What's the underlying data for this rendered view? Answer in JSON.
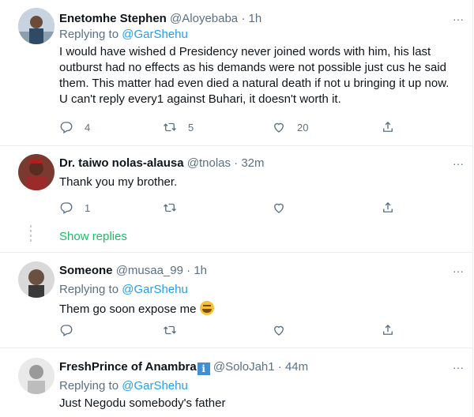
{
  "tweets": [
    {
      "name": "Enetomhe Stephen",
      "handle": "@Aloyebaba",
      "dot": "·",
      "time": "1h",
      "replying_label": "Replying to",
      "replying_to": "@GarShehu",
      "text": "I would have wished d Presidency never joined words with him, his last outburst had no effects as his demands were not possible just cus he said them. This matter had even died a natural death if not u bringing it up now. U can't reply every1 against Buhari, it doesn't worth it.",
      "reply_count": "4",
      "retweet_count": "5",
      "like_count": "20"
    },
    {
      "name": "Dr. taiwo nolas-alausa",
      "handle": "@tnolas",
      "dot": "·",
      "time": "32m",
      "text": "Thank you my brother.",
      "reply_count": "1",
      "retweet_count": "",
      "like_count": "",
      "show_replies": "Show replies"
    },
    {
      "name": "Someone",
      "handle": "@musaa_99",
      "dot": "·",
      "time": "1h",
      "replying_label": "Replying to",
      "replying_to": "@GarShehu",
      "text": "Them go soon expose me",
      "emoji": "grinning-squinting-face"
    },
    {
      "name": "FreshPrince of Anambra",
      "verified_badge": "i",
      "handle": "@SoloJah1",
      "dot": "·",
      "time": "44m",
      "replying_label": "Replying to",
      "replying_to": "@GarShehu",
      "text": "Just Negodu somebody's father"
    }
  ],
  "more_icon": "···",
  "colors": {
    "link": "#1da1f2",
    "secondary": "#5b7083",
    "show_replies": "#17bf63",
    "border": "#ebeef0"
  }
}
